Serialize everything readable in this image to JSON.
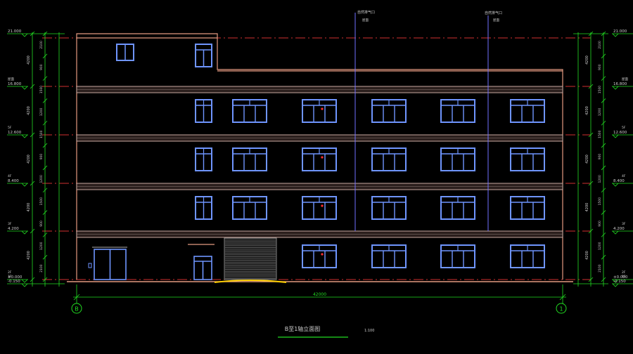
{
  "drawing": {
    "title": "B至1轴立面图",
    "scale": "1:100",
    "total_width_dim": "42000",
    "grid_left": "B",
    "grid_right": "1",
    "annotation_left": "自然排气口",
    "annotation_right": "自然排气口",
    "annotation_sub": "屋面",
    "colors": {
      "background": "#000000",
      "window": "#6f95ff",
      "outline": "#e49a80",
      "band": "#c8a8a0",
      "axis_line": "#d03030",
      "dimension": "#22dd22",
      "pipe": "#7070ff",
      "accent": "#ffd000"
    }
  },
  "levels": {
    "left": [
      "21.000",
      "16.800",
      "12.600",
      "8.400",
      "4.200",
      "±0.000",
      "-0.150"
    ],
    "left_names": [
      "",
      "屋面",
      "5F",
      "4F",
      "3F",
      "2F",
      "1F"
    ],
    "right": [
      "21.000",
      "16.800",
      "12.600",
      "8.400",
      "4.200",
      "±0.000",
      "-0.150"
    ],
    "right_names": [
      "",
      "屋面",
      "5F",
      "4F",
      "3F",
      "2F",
      "1F"
    ]
  },
  "dims_left": {
    "outer": [
      "4200",
      "4200",
      "4200",
      "4200",
      "4200"
    ],
    "inner": [
      "2100",
      "900",
      "1500",
      "1200",
      "1500",
      "900",
      "1200",
      "1500",
      "900",
      "1200",
      "2100"
    ]
  },
  "dims_right": {
    "outer": [
      "4200",
      "4200",
      "4200",
      "4200",
      "4200"
    ],
    "inner": [
      "2100",
      "900",
      "1500",
      "1200",
      "1500",
      "900",
      "1200",
      "1500",
      "900",
      "1200",
      "2100"
    ]
  }
}
